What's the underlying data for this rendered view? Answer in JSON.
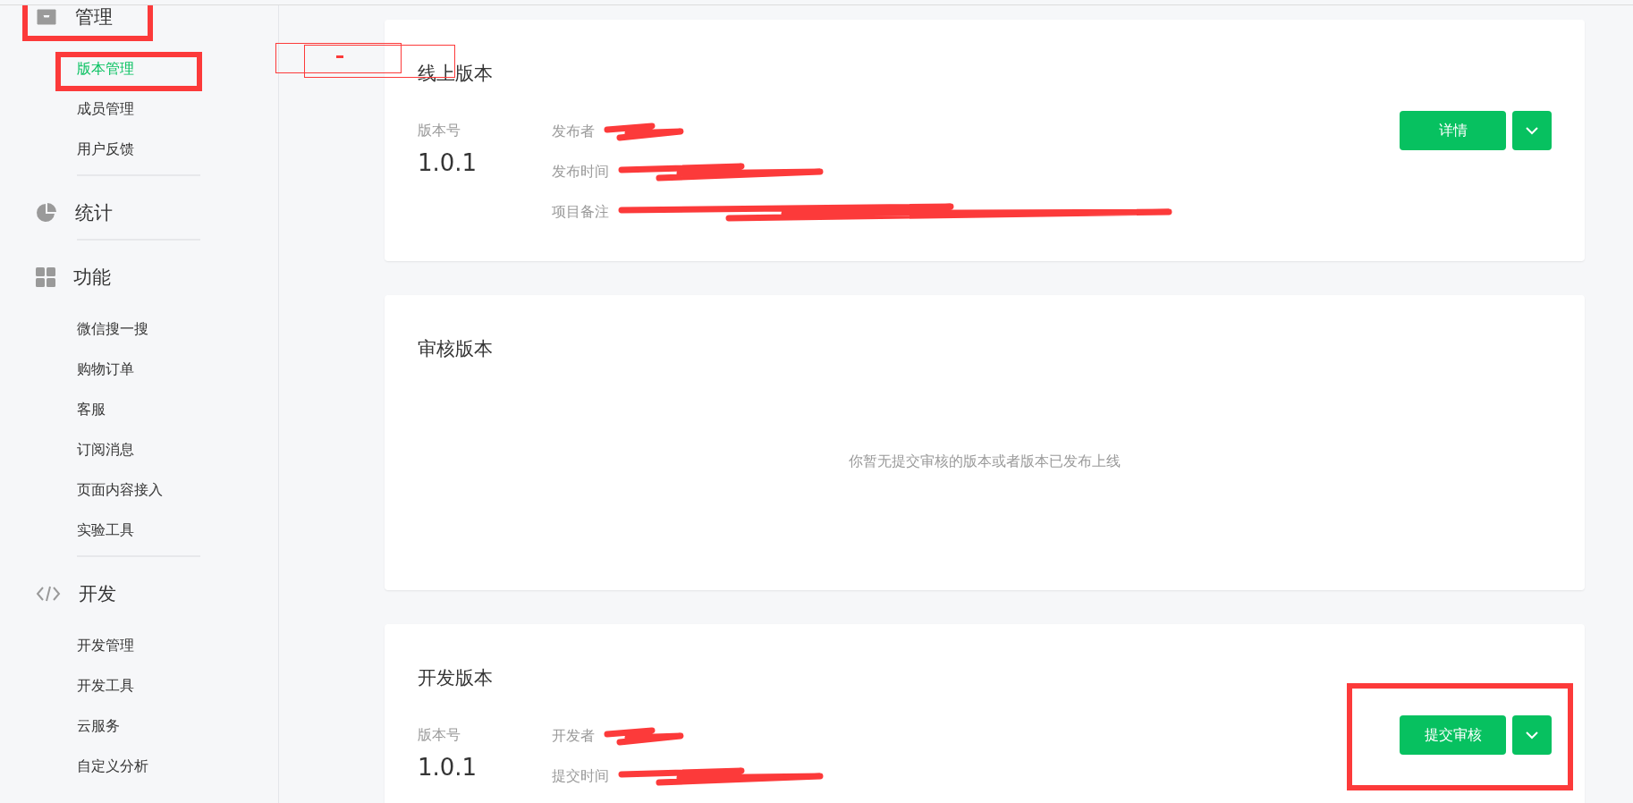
{
  "sidebar": {
    "sections": [
      {
        "title": "管理",
        "items": [
          {
            "label": "版本管理",
            "selected": true
          },
          {
            "label": "成员管理",
            "selected": false
          },
          {
            "label": "用户反馈",
            "selected": false
          }
        ]
      },
      {
        "title": "统计"
      },
      {
        "title": "功能",
        "items": [
          {
            "label": "微信搜一搜",
            "selected": false
          },
          {
            "label": "购物订单",
            "selected": false
          },
          {
            "label": "客服",
            "selected": false
          },
          {
            "label": "订阅消息",
            "selected": false
          },
          {
            "label": "页面内容接入",
            "selected": false
          },
          {
            "label": "实验工具",
            "selected": false
          }
        ]
      },
      {
        "title": "开发",
        "items": [
          {
            "label": "开发管理",
            "selected": false
          },
          {
            "label": "开发工具",
            "selected": false
          },
          {
            "label": "云服务",
            "selected": false
          },
          {
            "label": "自定义分析",
            "selected": false
          }
        ]
      }
    ]
  },
  "cards": [
    {
      "kind": "version",
      "title": "线上版本",
      "version_label": "版本号",
      "version": "1.0.1",
      "fields": [
        {
          "label": "发布者",
          "redacted": true
        },
        {
          "label": "发布时间",
          "redacted": true
        },
        {
          "label": "项目备注",
          "redacted": true
        }
      ],
      "button": "详情"
    },
    {
      "kind": "empty",
      "title": "审核版本",
      "message": "你暂无提交审核的版本或者版本已发布上线"
    },
    {
      "kind": "version",
      "title": "开发版本",
      "version_label": "版本号",
      "version": "1.0.1",
      "fields": [
        {
          "label": "开发者",
          "redacted": true
        },
        {
          "label": "提交时间",
          "redacted": true
        }
      ],
      "button": "提交审核"
    }
  ]
}
